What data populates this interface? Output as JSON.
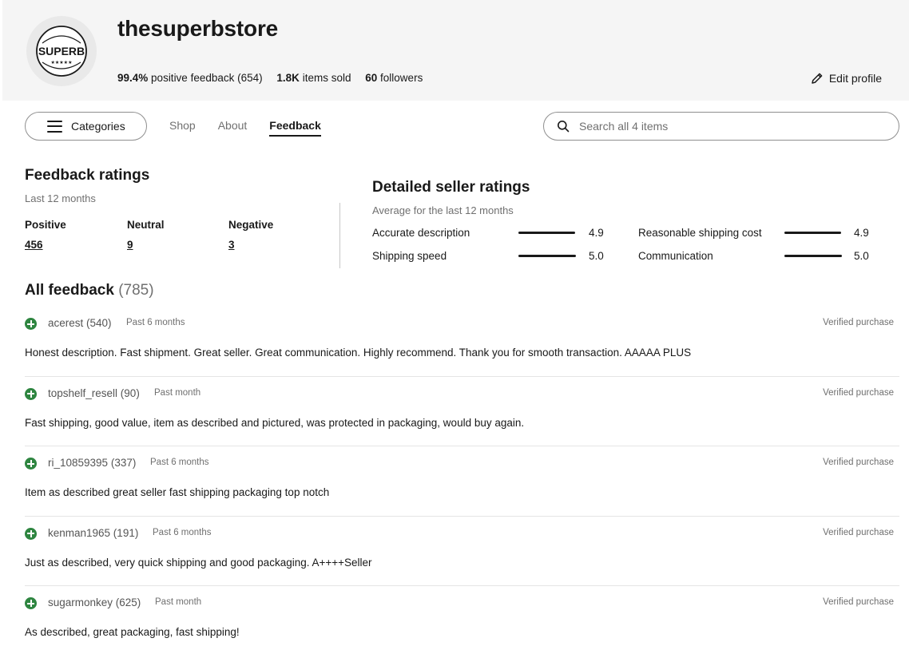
{
  "store": {
    "name": "thesuperbstore",
    "logo_text": "SUPERB",
    "logo_stars": "★★★★★",
    "positive_pct": "99.4%",
    "positive_label": "positive feedback (654)",
    "items_sold": "1.8K",
    "items_sold_label": "items sold",
    "followers": "60",
    "followers_label": "followers",
    "edit_profile": "Edit profile"
  },
  "nav": {
    "categories": "Categories",
    "tabs": [
      {
        "label": "Shop",
        "active": false
      },
      {
        "label": "About",
        "active": false
      },
      {
        "label": "Feedback",
        "active": true
      }
    ],
    "search_placeholder": "Search all 4 items"
  },
  "ratings": {
    "title": "Feedback ratings",
    "subtitle": "Last 12 months",
    "positive_label": "Positive",
    "positive_value": "456",
    "neutral_label": "Neutral",
    "neutral_value": "9",
    "negative_label": "Negative",
    "negative_value": "3"
  },
  "dsr": {
    "title": "Detailed seller ratings",
    "subtitle": "Average for the last 12 months",
    "items": [
      {
        "label": "Accurate description",
        "score": "4.9",
        "fill": 0.98
      },
      {
        "label": "Reasonable shipping cost",
        "score": "4.9",
        "fill": 0.98
      },
      {
        "label": "Shipping speed",
        "score": "5.0",
        "fill": 1.0
      },
      {
        "label": "Communication",
        "score": "5.0",
        "fill": 1.0
      }
    ]
  },
  "all_feedback": {
    "title": "All feedback",
    "count": "(785)",
    "items": [
      {
        "user": "acerest (540)",
        "time": "Past 6 months",
        "verified": "Verified purchase",
        "comment": "Honest description. Fast shipment. Great seller. Great communication. Highly recommend. Thank you for smooth transaction. AAAAA PLUS"
      },
      {
        "user": "topshelf_resell (90)",
        "time": "Past month",
        "verified": "Verified purchase",
        "comment": "Fast shipping, good value, item as described and pictured, was protected in packaging, would buy again."
      },
      {
        "user": "ri_10859395 (337)",
        "time": "Past 6 months",
        "verified": "Verified purchase",
        "comment": "Item as described great seller fast shipping packaging top notch"
      },
      {
        "user": "kenman1965 (191)",
        "time": "Past 6 months",
        "verified": "Verified purchase",
        "comment": "Just as described, very quick shipping and good packaging. A++++Seller"
      },
      {
        "user": "sugarmonkey (625)",
        "time": "Past month",
        "verified": "Verified purchase",
        "comment": "As described, great packaging, fast shipping!"
      }
    ]
  }
}
